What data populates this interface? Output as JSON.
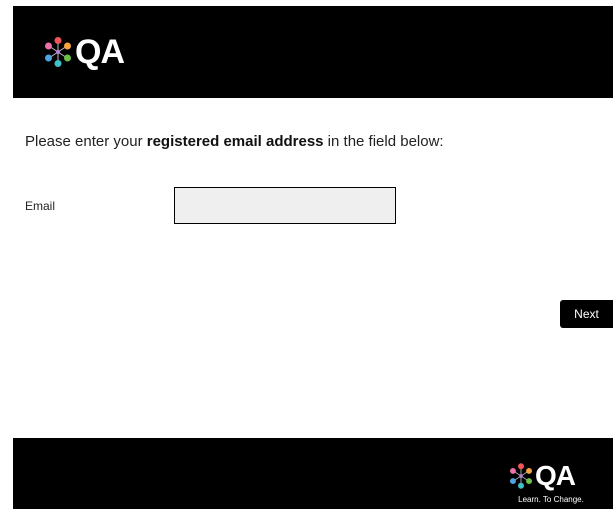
{
  "header": {
    "logo_text": "QA"
  },
  "instruction": {
    "prefix": "Please enter your ",
    "bold": "registered email address",
    "suffix": " in the field below:"
  },
  "form": {
    "email_label": "Email",
    "email_value": "",
    "email_placeholder": ""
  },
  "actions": {
    "next_label": "Next"
  },
  "footer": {
    "logo_text": "QA",
    "tagline": "Learn. To Change."
  },
  "icons": {
    "header_logo": "qa-dots-logo-icon",
    "footer_logo": "qa-dots-logo-icon"
  },
  "colors": {
    "header_bg": "#000000",
    "footer_bg": "#000000",
    "button_bg": "#000000",
    "input_bg": "#efefef",
    "logo_dot_red": "#f2545b",
    "logo_dot_orange": "#f7a541",
    "logo_dot_green": "#6cc04a",
    "logo_dot_blue": "#4fa3e0",
    "logo_dot_purple": "#b57edc",
    "logo_dot_pink": "#ef6fa8",
    "logo_dot_teal": "#3fc1c9"
  }
}
